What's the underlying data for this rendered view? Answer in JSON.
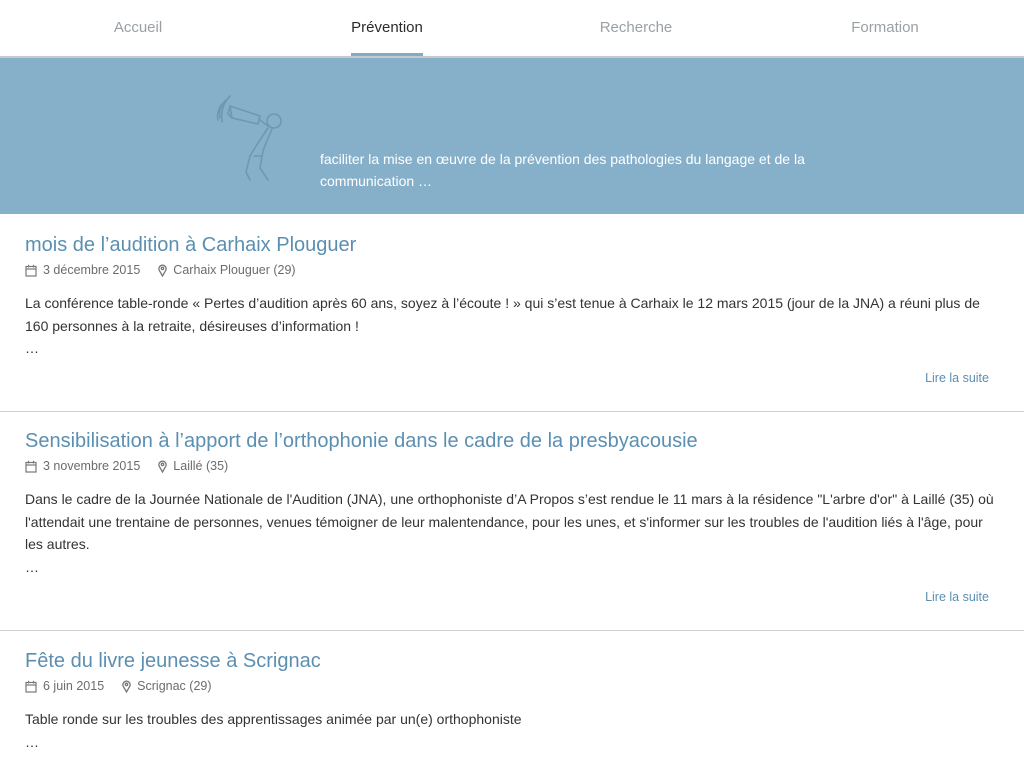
{
  "nav": {
    "tabs": [
      {
        "label": "Accueil"
      },
      {
        "label": "Prévention"
      },
      {
        "label": "Recherche"
      },
      {
        "label": "Formation"
      }
    ]
  },
  "banner": {
    "icon": "megaphone-person-icon",
    "text": "faciliter la mise en œuvre de la prévention des pathologies du langage et de la communication …"
  },
  "articles": [
    {
      "title": "mois de l’audition à Carhaix Plouguer",
      "date": "3 décembre 2015",
      "location": "Carhaix Plouguer (29)",
      "body": "La conférence table-ronde « Pertes d’audition après 60 ans, soyez à l’écoute ! » qui s’est tenue à Carhaix le 12 mars 2015 (jour de la JNA) a réuni plus de 160 personnes à la retraite, désireuses d’information !",
      "ellipsis": "…",
      "more": "Lire la suite"
    },
    {
      "title": "Sensibilisation à l’apport de l’orthophonie dans le cadre de la presbyacousie",
      "date": "3 novembre 2015",
      "location": "Laillé (35)",
      "body": "Dans le cadre de la Journée Nationale de l'Audition (JNA), une orthophoniste d’A Propos s’est rendue le 11 mars à la résidence \"L'arbre d'or\" à Laillé (35) où l'attendait une trentaine de personnes, venues témoigner de leur malentendance, pour les unes, et s'informer sur les troubles de l'audition liés à l'âge, pour les autres.",
      "ellipsis": "…",
      "more": "Lire la suite"
    },
    {
      "title": "Fête du livre jeunesse à Scrignac",
      "date": "6 juin 2015",
      "location": "Scrignac (29)",
      "body": "Table ronde sur les troubles des apprentissages animée par un(e) orthophoniste",
      "ellipsis": "…"
    }
  ],
  "colors": {
    "accent": "#5b8fb2",
    "banner": "#86b0c9",
    "tab_underline": "#7fadc9"
  }
}
